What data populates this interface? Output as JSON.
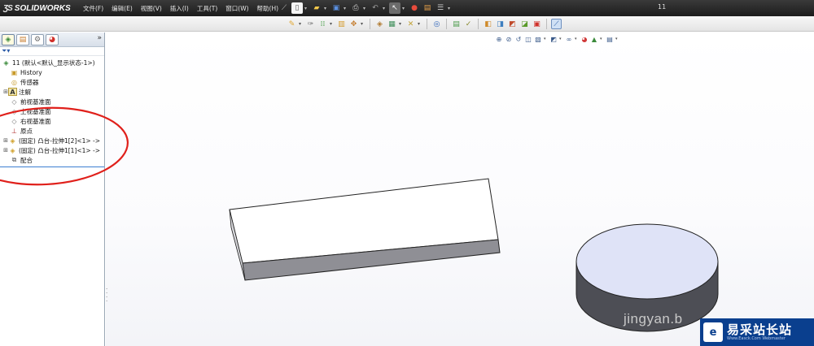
{
  "app": {
    "logo_text": "SOLIDWORKS",
    "document_title": "11"
  },
  "menu": {
    "items": [
      "文件(F)",
      "编辑(E)",
      "视图(V)",
      "插入(I)",
      "工具(T)",
      "窗口(W)",
      "帮助(H)"
    ]
  },
  "feature_tree": {
    "root": "11  (默认<默认_显示状态-1>)",
    "items": [
      {
        "label": "History",
        "icon": "history-icon",
        "expandable": false
      },
      {
        "label": "传感器",
        "icon": "sensor-icon",
        "expandable": false
      },
      {
        "label": "注解",
        "icon": "annotation-icon",
        "expandable": true
      },
      {
        "label": "前视基准面",
        "icon": "plane-icon",
        "expandable": false
      },
      {
        "label": "上视基准面",
        "icon": "plane-icon",
        "expandable": false
      },
      {
        "label": "右视基准面",
        "icon": "plane-icon",
        "expandable": false
      },
      {
        "label": "原点",
        "icon": "origin-icon",
        "expandable": false
      },
      {
        "label": "(固定) 凸台-拉伸1[2]<1> ->",
        "icon": "part-icon",
        "expandable": true
      },
      {
        "label": "(固定) 凸台-拉伸1[1]<1> ->",
        "icon": "part-icon",
        "expandable": true
      },
      {
        "label": "配合",
        "icon": "mates-icon",
        "expandable": false
      }
    ]
  },
  "watermark": {
    "text": "jingyan.b",
    "brand_name": "易采站长站",
    "brand_url": "Www.Easck.Com  Webmaster"
  },
  "colors": {
    "titlebar": "#262626",
    "annotation": "#e0201b",
    "brand": "#0a3f8e",
    "tree_accent": "#3d7fd1"
  }
}
